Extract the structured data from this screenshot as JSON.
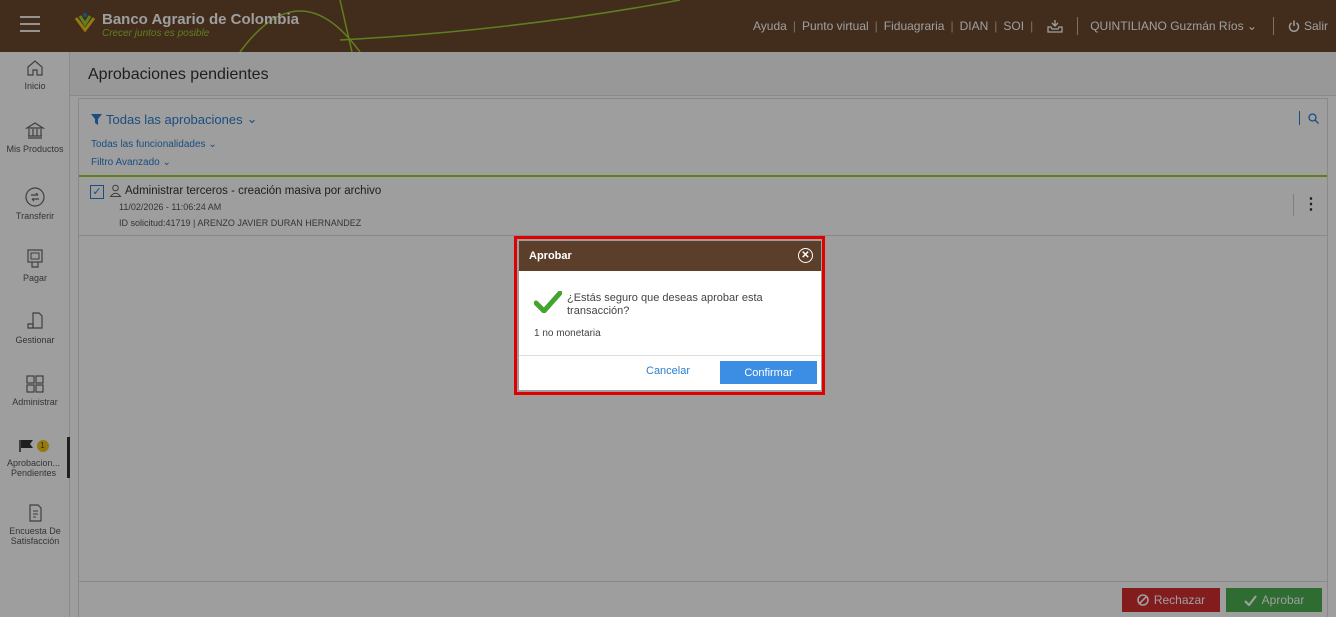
{
  "topbar": {
    "brand_name": "Banco Agrario de Colombia",
    "brand_tagline": "Crecer juntos es posible",
    "links": [
      "Ayuda",
      "Punto virtual",
      "Fiduagraria",
      "DIAN",
      "SOI"
    ],
    "user_name": "QUINTILIANO Guzmán Ríos",
    "logout_label": "Salir"
  },
  "sidebar": {
    "items": [
      {
        "label": "Inicio",
        "icon": "home-icon"
      },
      {
        "label": "Mis Productos",
        "icon": "bank-icon"
      },
      {
        "label": "Transferir",
        "icon": "transfer-icon"
      },
      {
        "label": "Pagar",
        "icon": "payment-icon"
      },
      {
        "label": "Gestionar",
        "icon": "manage-icon"
      },
      {
        "label": "Administrar",
        "icon": "grid-icon"
      },
      {
        "label": "Aprobacion... Pendientes",
        "icon": "flag-icon",
        "badge": "1"
      },
      {
        "label": "Encuesta De Satisfacción",
        "icon": "survey-icon"
      }
    ]
  },
  "page": {
    "title": "Aprobaciones pendientes"
  },
  "filters": {
    "approvals_filter": "Todas las aprobaciones",
    "functionalities_filter": "Todas las funcionalidades",
    "advanced_filter": "Filtro Avanzado"
  },
  "list": {
    "items": [
      {
        "title": "Administrar terceros - creación masiva por archivo",
        "datetime": "11/02/2026 - 11:06:24 AM",
        "details": "ID solicitud:41719 | ARENZO JAVIER DURAN HERNANDEZ"
      }
    ]
  },
  "actions": {
    "reject_label": "Rechazar",
    "approve_label": "Aprobar"
  },
  "modal": {
    "title": "Aprobar",
    "question": "¿Estás seguro que deseas aprobar esta transacción?",
    "note": "1 no monetaria",
    "cancel_label": "Cancelar",
    "confirm_label": "Confirmar"
  },
  "colors": {
    "topbar": "#6b4a2e",
    "modal_header": "#5c3f2a",
    "accent_blue": "#2a7fcf",
    "brand_green": "#9acd32",
    "reject_red": "#d32f2f",
    "approve_green": "#4caf50",
    "highlight_red": "#e10000"
  }
}
